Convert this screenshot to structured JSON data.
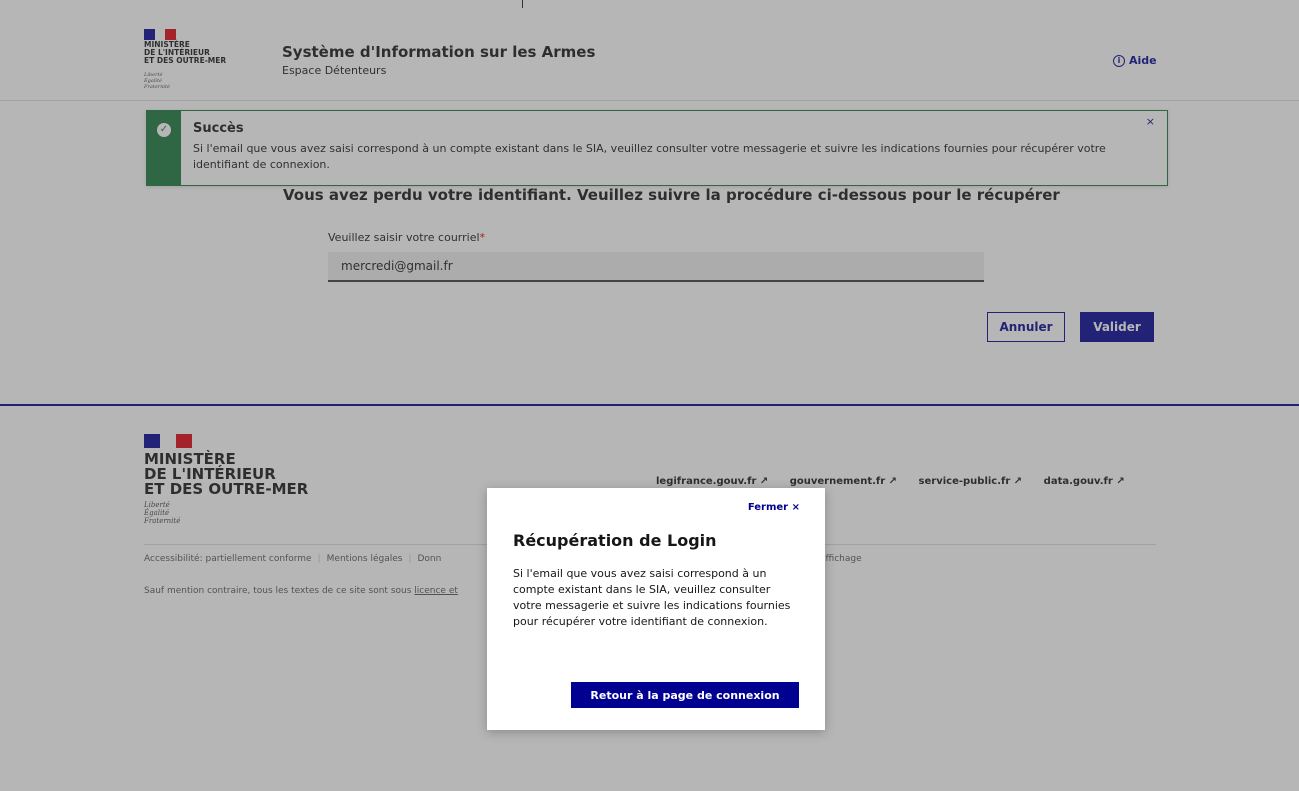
{
  "header": {
    "logo_lines": "MINISTÈRE\nDE L'INTÉRIEUR\nET DES OUTRE-MER",
    "logo_motto": "Liberté\nÉgalité\nFraternité",
    "title": "Système d'Information sur les Armes",
    "subtitle": "Espace Détenteurs",
    "help_label": "Aide"
  },
  "alert": {
    "title": "Succès",
    "message": "Si l'email que vous avez saisi correspond à un compte existant dans le SIA, veuillez consulter votre messagerie et suivre les indications fournies pour récupérer votre identifiant de connexion.",
    "close": "×"
  },
  "form": {
    "heading": "Vous avez perdu votre identifiant. Veuillez suivre la procédure ci-dessous pour le récupérer",
    "email_label": "Veuillez saisir votre courriel",
    "required_mark": "*",
    "email_value": "mercredi@gmail.fr",
    "cancel_label": "Annuler",
    "submit_label": "Valider"
  },
  "footer": {
    "logo_lines": "MINISTÈRE\nDE L'INTÉRIEUR\nET DES OUTRE-MER",
    "logo_motto": "Liberté\nÉgalité\nFraternité",
    "links": [
      "legifrance.gouv.fr ↗",
      "gouvernement.fr ↗",
      "service-public.fr ↗",
      "data.gouv.fr ↗"
    ],
    "bottom_links": [
      "Accessibilité: partiellement conforme",
      "Mentions légales",
      "Donn"
    ],
    "bottom_extra": "affichage",
    "license_text": "Sauf mention contraire, tous les textes de ce site sont sous",
    "license_link": "licence et"
  },
  "modal": {
    "close_label": "Fermer",
    "close_icon": "×",
    "title": "Récupération de Login",
    "text": "Si l'email que vous avez saisi correspond à un compte existant dans le SIA, veuillez consulter votre messagerie et suivre les indications fournies pour récupérer votre identifiant de connexion.",
    "button_label": "Retour à la page de connexion"
  },
  "colors": {
    "primary": "#000091",
    "success": "#18753c",
    "flag_blue": "#000091",
    "flag_red": "#e1000f"
  }
}
